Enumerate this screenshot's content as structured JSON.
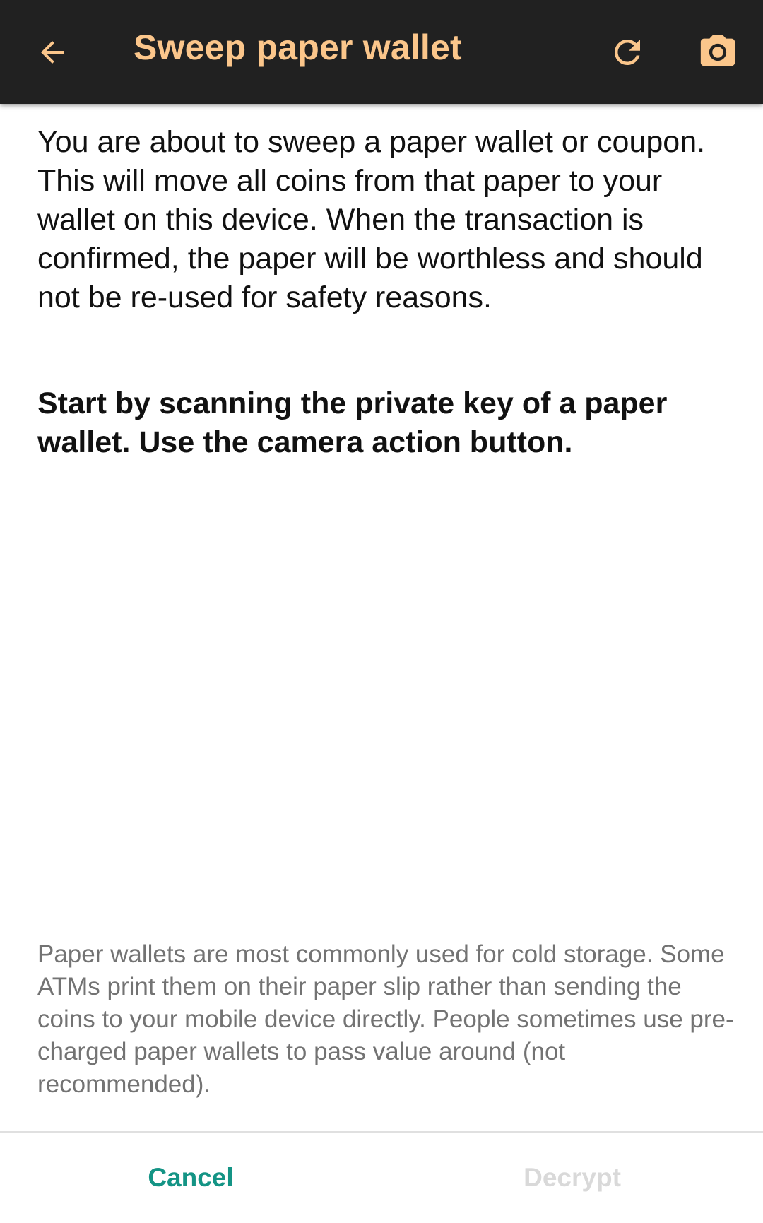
{
  "toolbar": {
    "title": "Sweep paper wallet",
    "title_color": "#fbc68b",
    "background": "#212121",
    "icons": {
      "back": "arrow-back-icon",
      "refresh": "refresh-icon",
      "camera": "camera-icon"
    }
  },
  "content": {
    "intro": "You are about to sweep a paper wallet or coupon. This will move all coins from that paper to your wallet on this device. When the transaction is confirmed, the paper will be worthless and should not be re-used for safety reasons.",
    "instruction": "Start by scanning the private key of a paper wallet. Use the camera action button.",
    "info": "Paper wallets are most commonly used for cold storage. Some ATMs print them on their paper slip rather than sending the coins to your mobile device directly. People sometimes use pre-charged paper wallets to pass value around (not recommended)."
  },
  "actions": {
    "cancel_label": "Cancel",
    "cancel_color": "#149485",
    "decrypt_label": "Decrypt",
    "decrypt_color": "#d9d9d9"
  }
}
